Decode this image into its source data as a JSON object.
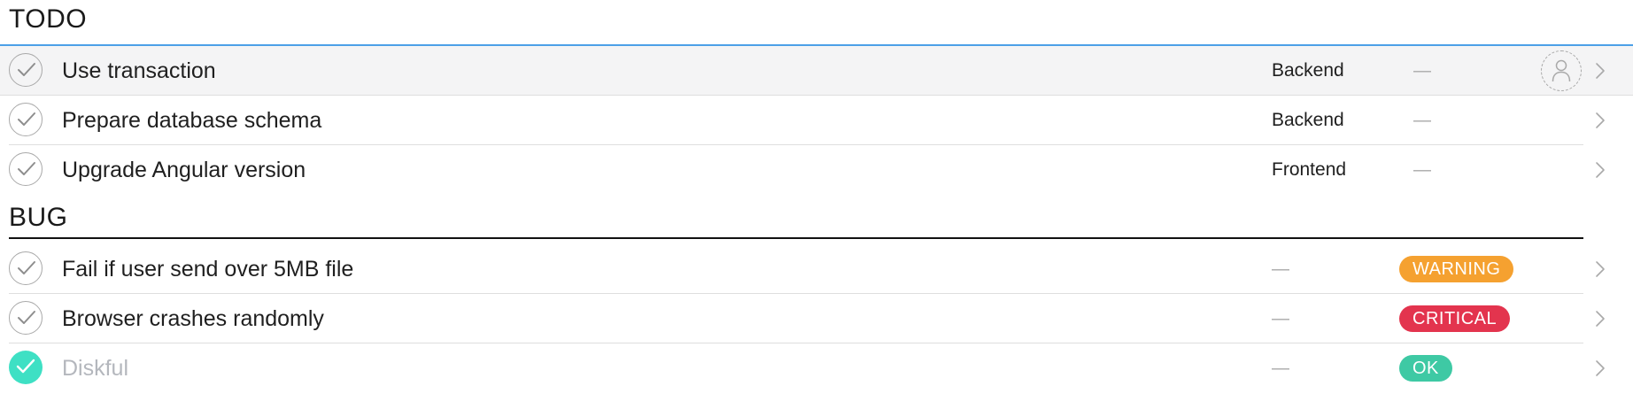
{
  "sections": [
    {
      "title": "TODO",
      "accent_color": "#2d8fe3",
      "rows": [
        {
          "title": "Use transaction",
          "category": "Backend",
          "status": "—",
          "completed": false,
          "assignee_icon": "user-placeholder-icon"
        },
        {
          "title": "Prepare database schema",
          "category": "Backend",
          "status": "—",
          "completed": false
        },
        {
          "title": "Upgrade Angular version",
          "category": "Frontend",
          "status": "—",
          "completed": false
        }
      ]
    },
    {
      "title": "BUG",
      "accent_color": "#111111",
      "rows": [
        {
          "title": "Fail if user send over 5MB file",
          "category": "—",
          "status": "WARNING",
          "status_color": "#f5a130",
          "completed": false
        },
        {
          "title": "Browser crashes randomly",
          "category": "—",
          "status": "CRITICAL",
          "status_color": "#e3344e",
          "completed": false
        },
        {
          "title": "Diskful",
          "category": "—",
          "status": "OK",
          "status_color": "#3ec9a4",
          "completed": true,
          "check_color": "#3ee0c4"
        }
      ]
    }
  ],
  "icons": {
    "check": "check-icon",
    "chevron": "chevron-right-icon",
    "avatar": "user-placeholder-icon"
  }
}
